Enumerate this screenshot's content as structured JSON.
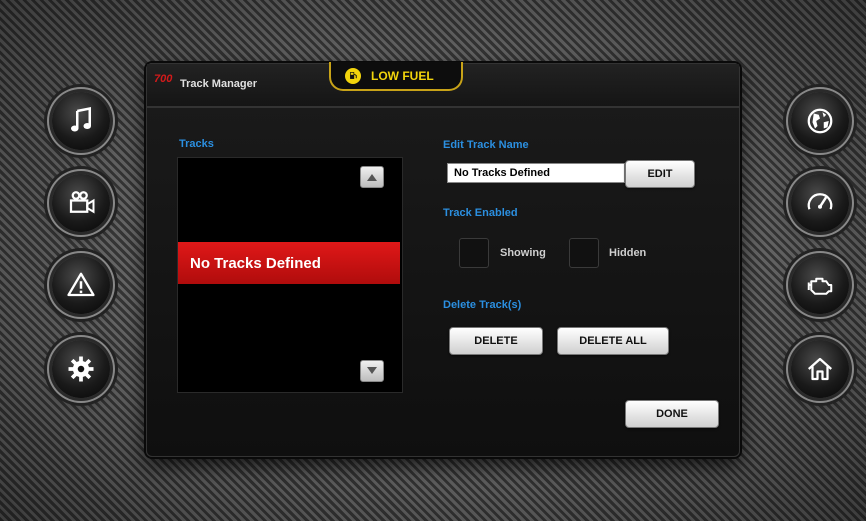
{
  "side_left": [
    {
      "icon": "music-note-icon"
    },
    {
      "icon": "video-camera-icon"
    },
    {
      "icon": "warning-icon"
    },
    {
      "icon": "gear-icon"
    }
  ],
  "side_right": [
    {
      "icon": "globe-icon"
    },
    {
      "icon": "speedometer-icon"
    },
    {
      "icon": "engine-icon"
    },
    {
      "icon": "home-icon"
    }
  ],
  "header": {
    "model": "700",
    "title": "Track Manager",
    "fuel_warning": "LOW FUEL",
    "fuel_icon": "fuel-pump-icon",
    "fuel_color": "#f2d40c"
  },
  "tracks": {
    "label": "Tracks",
    "items": [
      "No Tracks Defined"
    ],
    "selected_color": "#e01818"
  },
  "edit": {
    "label": "Edit Track Name",
    "value": "No Tracks Defined",
    "button": "EDIT"
  },
  "enabled": {
    "label": "Track Enabled",
    "showing": "Showing",
    "hidden": "Hidden"
  },
  "delete": {
    "label": "Delete Track(s)",
    "delete_button": "DELETE",
    "delete_all_button": "DELETE ALL"
  },
  "footer": {
    "done_button": "DONE"
  },
  "accent_color": "#2b8fe0"
}
